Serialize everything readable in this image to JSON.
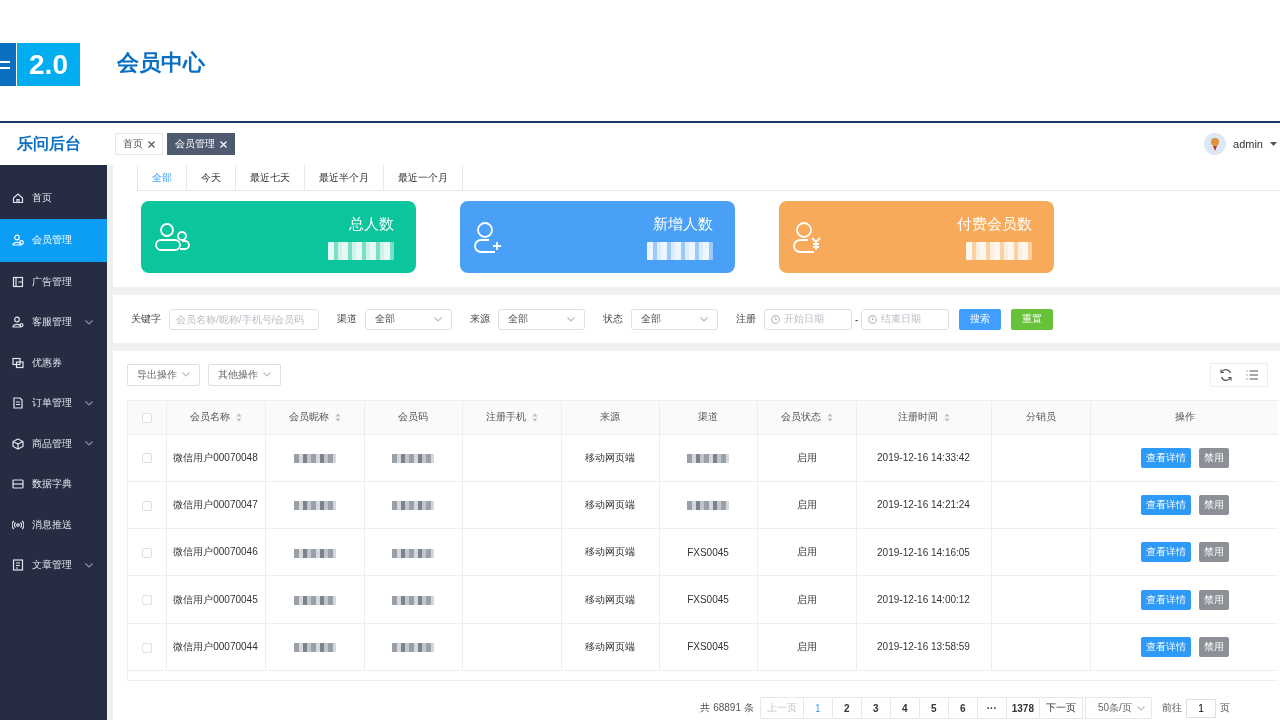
{
  "slide_header": {
    "badge": "2.0",
    "title": "会员中心"
  },
  "app": {
    "logo": "乐问后台",
    "user": "admin"
  },
  "open_tabs": [
    {
      "label": "首页",
      "selected": false
    },
    {
      "label": "会员管理",
      "selected": true
    }
  ],
  "sidebar": {
    "items": [
      {
        "label": "首页",
        "selected": false,
        "has_submenu": false
      },
      {
        "label": "会员管理",
        "selected": true,
        "has_submenu": false
      },
      {
        "label": "广告管理",
        "selected": false,
        "has_submenu": false
      },
      {
        "label": "客服管理",
        "selected": false,
        "has_submenu": true
      },
      {
        "label": "优惠券",
        "selected": false,
        "has_submenu": false
      },
      {
        "label": "订单管理",
        "selected": false,
        "has_submenu": true
      },
      {
        "label": "商品管理",
        "selected": false,
        "has_submenu": true
      },
      {
        "label": "数据字典",
        "selected": false,
        "has_submenu": false
      },
      {
        "label": "消息推送",
        "selected": false,
        "has_submenu": false
      },
      {
        "label": "文章管理",
        "selected": false,
        "has_submenu": true
      }
    ]
  },
  "period_tabs": [
    {
      "label": "全部",
      "selected": true
    },
    {
      "label": "今天",
      "selected": false
    },
    {
      "label": "最近七天",
      "selected": false
    },
    {
      "label": "最近半个月",
      "selected": false
    },
    {
      "label": "最近一个月",
      "selected": false
    }
  ],
  "stat_cards": [
    {
      "title": "总人数",
      "color": "#0bc59d"
    },
    {
      "title": "新增人数",
      "color": "#4aa0f7"
    },
    {
      "title": "付费会员数",
      "color": "#f7ab5a"
    }
  ],
  "filters": {
    "keyword": {
      "label": "关键字",
      "placeholder": "会员名称/昵称/手机号/会员码"
    },
    "selects": [
      {
        "label": "渠道",
        "value": "全部"
      },
      {
        "label": "来源",
        "value": "全部"
      },
      {
        "label": "状态",
        "value": "全部"
      }
    ],
    "date": {
      "label": "注册",
      "start_placeholder": "开始日期",
      "separator": "-",
      "end_placeholder": "结束日期"
    },
    "buttons": [
      {
        "label": "搜索",
        "kind": "primary"
      },
      {
        "label": "重置",
        "kind": "success"
      }
    ]
  },
  "toolbar": {
    "dropdowns": [
      "导出操作",
      "其他操作"
    ]
  },
  "table": {
    "select_all_checked": false,
    "columns": [
      {
        "label": "会员名称",
        "sortable": true
      },
      {
        "label": "会员昵称",
        "sortable": true
      },
      {
        "label": "会员码",
        "sortable": false
      },
      {
        "label": "注册手机",
        "sortable": true
      },
      {
        "label": "来源",
        "sortable": false
      },
      {
        "label": "渠道",
        "sortable": false
      },
      {
        "label": "会员状态",
        "sortable": true
      },
      {
        "label": "注册时间",
        "sortable": true
      },
      {
        "label": "分销员",
        "sortable": false
      },
      {
        "label": "操作",
        "sortable": false
      }
    ],
    "rows": [
      {
        "checked": false,
        "cells": [
          {
            "kind": "text",
            "text": "微信用户00070048"
          },
          {
            "kind": "redacted"
          },
          {
            "kind": "redacted"
          },
          {
            "kind": "empty"
          },
          {
            "kind": "text",
            "text": "移动网页端"
          },
          {
            "kind": "redacted"
          },
          {
            "kind": "text",
            "text": "启用"
          },
          {
            "kind": "text",
            "text": "2019-12-16 14:33:42"
          },
          {
            "kind": "empty"
          }
        ],
        "actions": [
          {
            "label": "查看详情",
            "kind": "primary"
          },
          {
            "label": "禁用",
            "kind": "muted"
          }
        ]
      },
      {
        "checked": false,
        "cells": [
          {
            "kind": "text",
            "text": "微信用户00070047"
          },
          {
            "kind": "redacted"
          },
          {
            "kind": "redacted"
          },
          {
            "kind": "empty"
          },
          {
            "kind": "text",
            "text": "移动网页端"
          },
          {
            "kind": "redacted"
          },
          {
            "kind": "text",
            "text": "启用"
          },
          {
            "kind": "text",
            "text": "2019-12-16 14:21:24"
          },
          {
            "kind": "empty"
          }
        ],
        "actions": [
          {
            "label": "查看详情",
            "kind": "primary"
          },
          {
            "label": "禁用",
            "kind": "muted"
          }
        ]
      },
      {
        "checked": false,
        "cells": [
          {
            "kind": "text",
            "text": "微信用户00070046"
          },
          {
            "kind": "redacted"
          },
          {
            "kind": "redacted"
          },
          {
            "kind": "empty"
          },
          {
            "kind": "text",
            "text": "移动网页端"
          },
          {
            "kind": "text",
            "text": "FXS0045"
          },
          {
            "kind": "text",
            "text": "启用"
          },
          {
            "kind": "text",
            "text": "2019-12-16 14:16:05"
          },
          {
            "kind": "empty"
          }
        ],
        "actions": [
          {
            "label": "查看详情",
            "kind": "primary"
          },
          {
            "label": "禁用",
            "kind": "muted"
          }
        ]
      },
      {
        "checked": false,
        "cells": [
          {
            "kind": "text",
            "text": "微信用户00070045"
          },
          {
            "kind": "redacted"
          },
          {
            "kind": "redacted"
          },
          {
            "kind": "empty"
          },
          {
            "kind": "text",
            "text": "移动网页端"
          },
          {
            "kind": "text",
            "text": "FXS0045"
          },
          {
            "kind": "text",
            "text": "启用"
          },
          {
            "kind": "text",
            "text": "2019-12-16 14:00:12"
          },
          {
            "kind": "empty"
          }
        ],
        "actions": [
          {
            "label": "查看详情",
            "kind": "primary"
          },
          {
            "label": "禁用",
            "kind": "muted"
          }
        ]
      },
      {
        "checked": false,
        "cells": [
          {
            "kind": "text",
            "text": "微信用户00070044"
          },
          {
            "kind": "redacted"
          },
          {
            "kind": "redacted"
          },
          {
            "kind": "empty"
          },
          {
            "kind": "text",
            "text": "移动网页端"
          },
          {
            "kind": "text",
            "text": "FXS0045"
          },
          {
            "kind": "text",
            "text": "启用"
          },
          {
            "kind": "text",
            "text": "2019-12-16 13:58:59"
          },
          {
            "kind": "empty"
          }
        ],
        "actions": [
          {
            "label": "查看详情",
            "kind": "primary"
          },
          {
            "label": "禁用",
            "kind": "muted"
          }
        ]
      }
    ]
  },
  "pagination": {
    "total": "共 68891 条",
    "prev": {
      "label": "上一页",
      "disabled": true
    },
    "pages": [
      {
        "label": "1",
        "selected": true
      },
      {
        "label": "2",
        "selected": false
      },
      {
        "label": "3",
        "selected": false
      },
      {
        "label": "4",
        "selected": false
      },
      {
        "label": "5",
        "selected": false
      },
      {
        "label": "6",
        "selected": false
      },
      {
        "label": "···",
        "selected": false
      },
      {
        "label": "1378",
        "selected": false
      }
    ],
    "next": {
      "label": "下一页",
      "disabled": false
    },
    "page_size": "50条/页",
    "goto_label": "前往",
    "goto_value": "1",
    "goto_suffix": "页"
  }
}
